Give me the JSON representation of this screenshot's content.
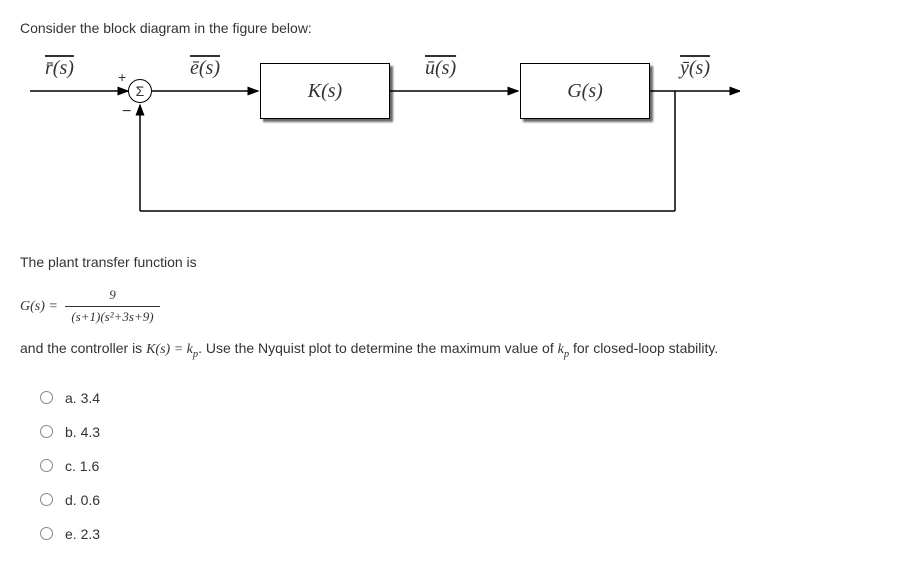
{
  "intro": "Consider the block diagram in the figure below:",
  "diagram": {
    "r": "r̄(s)",
    "e": "ē(s)",
    "u": "ū(s)",
    "y": "ȳ(s)",
    "sum": "Σ",
    "plus": "+",
    "minus": "−",
    "K": "K(s)",
    "G": "G(s)"
  },
  "plant_intro": "The plant transfer function is",
  "gs_lhs": "G(s) = ",
  "frac_num": "9",
  "frac_den": "(s+1)(s²+3s+9)",
  "ctrl_line_1": "and the controller is ",
  "ctrl_eq": "K(s) = k",
  "ctrl_sub": "p",
  "ctrl_line_2": ". Use the Nyquist plot to determine the maximum value of ",
  "kp_k": "k",
  "kp_sub": "p",
  "ctrl_line_3": " for closed-loop stability.",
  "options": [
    {
      "label": "a. 3.4"
    },
    {
      "label": "b. 4.3"
    },
    {
      "label": "c. 1.6"
    },
    {
      "label": "d. 0.6"
    },
    {
      "label": "e. 2.3"
    }
  ]
}
